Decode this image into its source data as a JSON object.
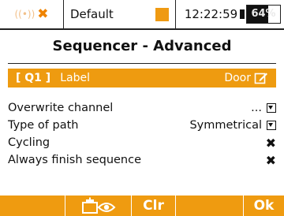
{
  "status": {
    "signal_icon": "signal-waves-icon",
    "signal_status": "disconnected",
    "model_name": "Default",
    "time": "12:22:59",
    "battery_percent": 64,
    "battery_label": "64%"
  },
  "page": {
    "title": "Sequencer - Advanced"
  },
  "selected": {
    "index_label": "[ Q1 ]",
    "field_label": "Label",
    "field_value": "Door",
    "edit_icon": "edit-icon"
  },
  "settings": [
    {
      "name": "Overwrite channel",
      "value": "...",
      "control": "dropdown"
    },
    {
      "name": "Type of path",
      "value": "Symmetrical",
      "control": "dropdown"
    },
    {
      "name": "Cycling",
      "value": "✖",
      "control": "toggle"
    },
    {
      "name": "Always finish sequence",
      "value": "✖",
      "control": "toggle"
    }
  ],
  "toolbar": {
    "monitor_icon": "servo-monitor-icon",
    "clr_label": "Clr",
    "ok_label": "Ok"
  },
  "colors": {
    "accent": "#ee9b10",
    "text": "#111111",
    "background": "#ffffff"
  }
}
